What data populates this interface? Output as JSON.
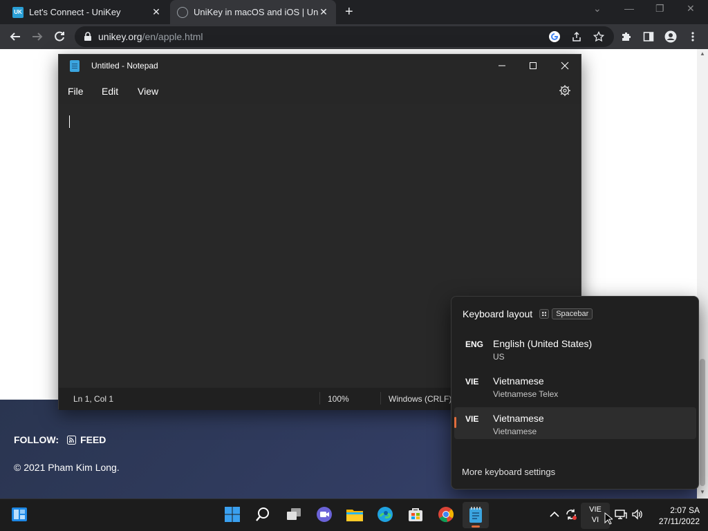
{
  "browser": {
    "tabs": [
      {
        "title": "Let's Connect - UniKey",
        "favicon": "UK",
        "active": false
      },
      {
        "title": "UniKey in macOS and iOS | UniK",
        "favicon": "globe-icon",
        "active": true
      }
    ],
    "new_tab": "+",
    "url_host": "unikey.org",
    "url_path": "/en/apple.html"
  },
  "page": {
    "follow_label": "FOLLOW:",
    "feed_label": "FEED",
    "copyright": "© 2021 Pham Kim Long."
  },
  "notepad": {
    "title": "Untitled - Notepad",
    "menu": [
      "File",
      "Edit",
      "View"
    ],
    "status": {
      "position": "Ln 1, Col 1",
      "zoom": "100%",
      "line_ending": "Windows (CRLF)"
    }
  },
  "keyboard_flyout": {
    "header": "Keyboard layout",
    "shortcut": "Spacebar",
    "items": [
      {
        "code": "ENG",
        "language": "English (United States)",
        "layout": "US",
        "selected": false
      },
      {
        "code": "VIE",
        "language": "Vietnamese",
        "layout": "Vietnamese Telex",
        "selected": false
      },
      {
        "code": "VIE",
        "language": "Vietnamese",
        "layout": "Vietnamese",
        "selected": true
      }
    ],
    "more_settings": "More keyboard settings"
  },
  "taskbar": {
    "apps": [
      "windows-start-icon",
      "start-icon",
      "search-icon",
      "task-view-icon",
      "chat-icon",
      "file-explorer-icon",
      "edge-icon",
      "store-icon",
      "chrome-icon",
      "notepad-icon"
    ],
    "input_indicator": {
      "line1": "VIE",
      "line2": "VI"
    },
    "clock": {
      "time": "2:07 SA",
      "date": "27/11/2022"
    }
  },
  "colors": {
    "accent": "#e06c3c",
    "chrome_bg": "#202124",
    "notepad_bg": "#272727",
    "footer_bg": "#2a3550"
  }
}
